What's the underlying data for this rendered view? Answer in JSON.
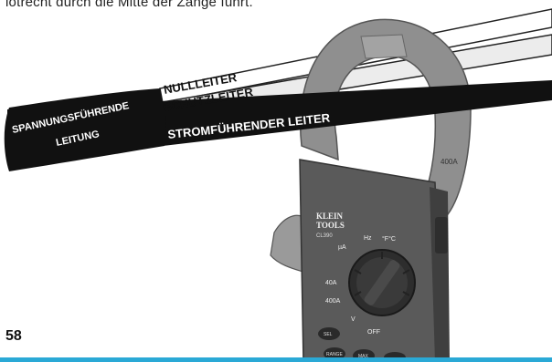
{
  "intro_text": "lotrecht durch die Mitte der Zange führt.",
  "labels": {
    "live_lead_line1": "SPANNUNGSFÜHRENDE",
    "live_lead_line2": "LEITUNG",
    "neutral": "NULLLEITER",
    "ground": "SCHUTZLEITER",
    "current_carrying": "STROMFÜHRENDER LEITER"
  },
  "meter": {
    "brand_line1": "KLEIN",
    "brand_line2": "TOOLS",
    "model": "CL390",
    "dial_labels": {
      "hz": "Hz",
      "temp": "°F°C",
      "ua": "µA",
      "a40": "40A",
      "a400": "400A",
      "volts": "V",
      "off": "OFF"
    },
    "buttons": {
      "sel": "SEL",
      "range": "RANGE",
      "max": "MAX"
    },
    "jaw_rating": "400A"
  },
  "page_number": "58",
  "colors": {
    "accent_bar": "#2aa9d6",
    "black_cable": "#111111",
    "meter_body": "#555555",
    "jaw": "#8a8a8a"
  }
}
